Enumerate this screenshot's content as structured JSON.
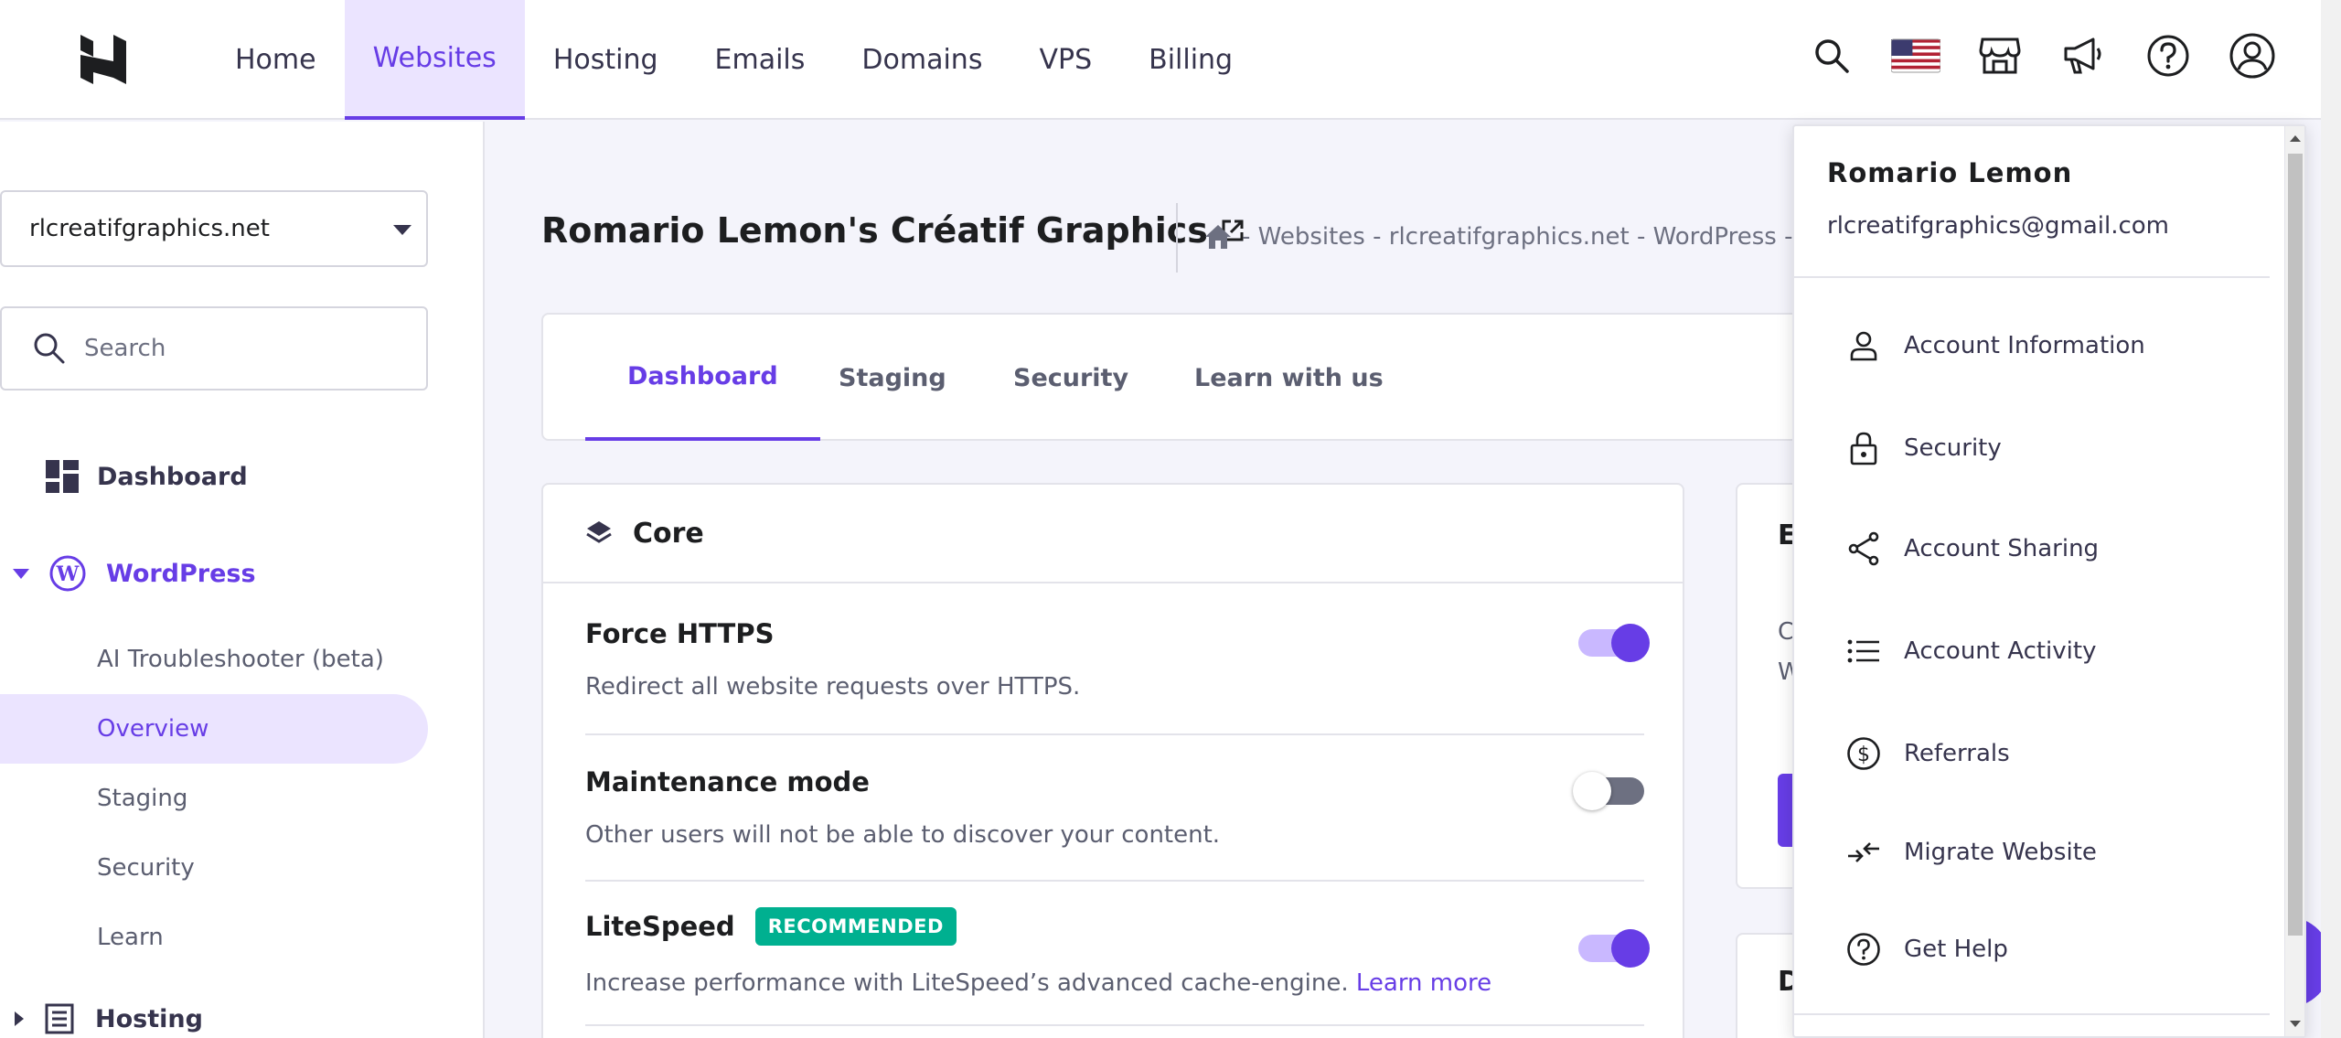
{
  "nav": {
    "items": [
      "Home",
      "Websites",
      "Hosting",
      "Emails",
      "Domains",
      "VPS",
      "Billing"
    ],
    "active": "Websites"
  },
  "top_icons": [
    "search-icon",
    "us-flag-icon",
    "store-icon",
    "megaphone-icon",
    "help-icon",
    "account-icon"
  ],
  "sidebar": {
    "domain_select": "rlcreatifgraphics.net",
    "search_placeholder": "Search",
    "dashboard": "Dashboard",
    "wordpress": "WordPress",
    "sub_items": [
      "AI Troubleshooter (beta)",
      "Overview",
      "Staging",
      "Security",
      "Learn"
    ],
    "active_sub": "Overview",
    "hosting": "Hosting"
  },
  "header": {
    "title": "Romario Lemon's Créatif Graphics",
    "breadcrumb": "- Websites - rlcreatifgraphics.net - WordPress - O"
  },
  "tabs": [
    "Dashboard",
    "Staging",
    "Security",
    "Learn with us"
  ],
  "core": {
    "title": "Core",
    "settings": [
      {
        "title": "Force HTTPS",
        "desc": "Redirect all website requests over HTTPS.",
        "enabled": true
      },
      {
        "title": "Maintenance mode",
        "desc": "Other users will not be able to discover your content.",
        "enabled": false
      },
      {
        "title": "LiteSpeed",
        "badge": "RECOMMENDED",
        "desc": "Increase performance with LiteSpeed’s advanced cache-engine.",
        "link": "Learn more",
        "enabled": true
      }
    ]
  },
  "right_cards": {
    "card1_letter": "E",
    "card1_line1": "C",
    "card1_line2": "W",
    "card2_letter": "D"
  },
  "account_menu": {
    "name": "Romario Lemon",
    "email": "rlcreatifgraphics@gmail.com",
    "items": [
      "Account Information",
      "Security",
      "Account Sharing",
      "Account Activity",
      "Referrals",
      "Migrate Website",
      "Get Help"
    ]
  },
  "colors": {
    "accent": "#673de6",
    "accent_light": "#ebe4ff",
    "badge": "#00b090"
  }
}
